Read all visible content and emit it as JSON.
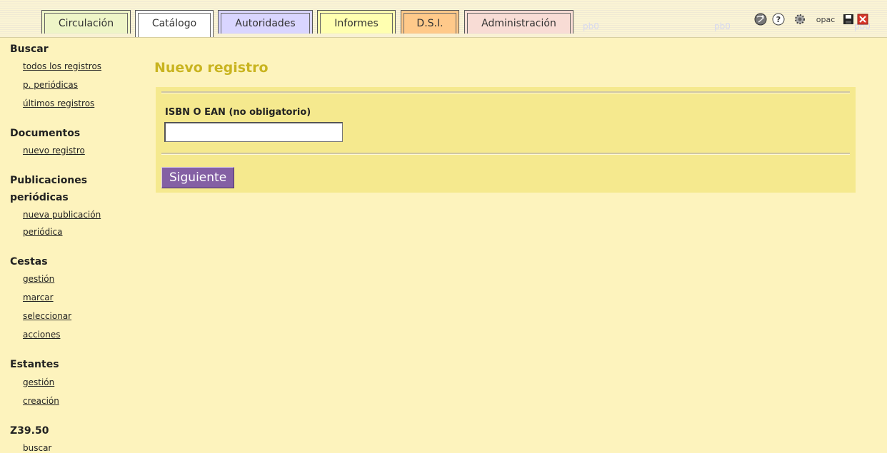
{
  "tabs": {
    "circulacion": "Circulación",
    "catalogo": "Catálogo",
    "autoridades": "Autoridades",
    "informes": "Informes",
    "dsi": "D.S.I.",
    "administracion": "Administración"
  },
  "watermark": "pb0",
  "top_icons": {
    "opac": "opac"
  },
  "sidebar": {
    "buscar": {
      "title": "Buscar",
      "items": [
        "todos los registros",
        "p. periódicas",
        "últimos registros"
      ]
    },
    "documentos": {
      "title": "Documentos",
      "items": [
        "nuevo registro"
      ]
    },
    "publicaciones": {
      "title_line1": "Publicaciones",
      "title_line2": "periódicas",
      "items": [
        "nueva publicación",
        "periódica"
      ]
    },
    "cestas": {
      "title": "Cestas",
      "items": [
        "gestión",
        "marcar",
        "seleccionar",
        "acciones"
      ]
    },
    "estantes": {
      "title": "Estantes",
      "items": [
        "gestión",
        "creación"
      ]
    },
    "z3950": {
      "title": "Z39.50",
      "items": [
        "buscar"
      ]
    }
  },
  "main": {
    "title": "Nuevo registro",
    "isbn_label": "ISBN O EAN (no obligatorio)",
    "isbn_value": "",
    "next_button": "Siguiente"
  },
  "colors": {
    "background": "#fdf3bd",
    "title": "#c9b420",
    "form_box": "#f5e98e",
    "button": "#8460a4"
  }
}
